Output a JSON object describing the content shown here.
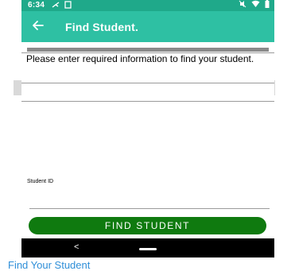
{
  "status_bar": {
    "time": "6:34",
    "left_icons": [
      "navigation-icon",
      "sim-icon"
    ],
    "right_icons": [
      "mute-icon",
      "wifi-icon",
      "battery-icon"
    ]
  },
  "app_bar": {
    "title": "Find Student.",
    "back_icon": "back-arrow-icon"
  },
  "form": {
    "prompt": "Please enter required information to find your student.",
    "first_field_value": "",
    "student_id_label": "Student ID",
    "student_id_value": "",
    "find_button_label": "FIND STUDENT"
  },
  "nav_bar": {
    "back_glyph": "<"
  },
  "caption": "Find Your Student",
  "colors": {
    "status_bar": "#1fa98a",
    "app_bar": "#2ec0a3",
    "button": "#0f7a0f",
    "caption": "#2f8fd8"
  }
}
